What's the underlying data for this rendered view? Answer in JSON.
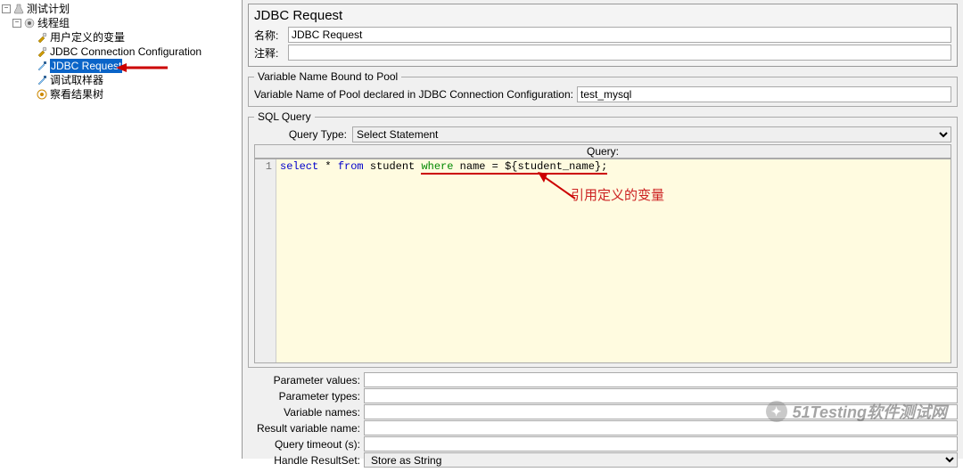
{
  "tree": {
    "root": "测试计划",
    "group": "线程组",
    "items": [
      "用户定义的变量",
      "JDBC Connection Configuration",
      "JDBC Request",
      "调试取样器",
      "察看结果树"
    ],
    "selected_index": 2
  },
  "header": {
    "title": "JDBC Request",
    "name_label": "名称:",
    "name_value": "JDBC Request",
    "comment_label": "注释:",
    "comment_value": ""
  },
  "pool": {
    "legend": "Variable Name Bound to Pool",
    "label": "Variable Name of Pool declared in JDBC Connection Configuration:",
    "value": "test_mysql"
  },
  "sql": {
    "legend": "SQL Query",
    "query_type_label": "Query Type:",
    "query_type_value": "Select Statement",
    "cell_header": "Query:",
    "line_no": "1",
    "code_tokens": {
      "select": "select",
      "star": " * ",
      "from": "from",
      "student": " student ",
      "where": "where",
      "cond": " name = ${student_name};"
    },
    "annotation": "引用定义的变量"
  },
  "bottom": {
    "param_values": {
      "label": "Parameter values:",
      "value": ""
    },
    "param_types": {
      "label": "Parameter types:",
      "value": ""
    },
    "var_names": {
      "label": "Variable names:",
      "value": ""
    },
    "result_var": {
      "label": "Result variable name:",
      "value": ""
    },
    "timeout": {
      "label": "Query timeout (s):",
      "value": ""
    },
    "handle_rs": {
      "label": "Handle ResultSet:",
      "value": "Store as String"
    }
  },
  "watermark": "51Testing软件测试网"
}
